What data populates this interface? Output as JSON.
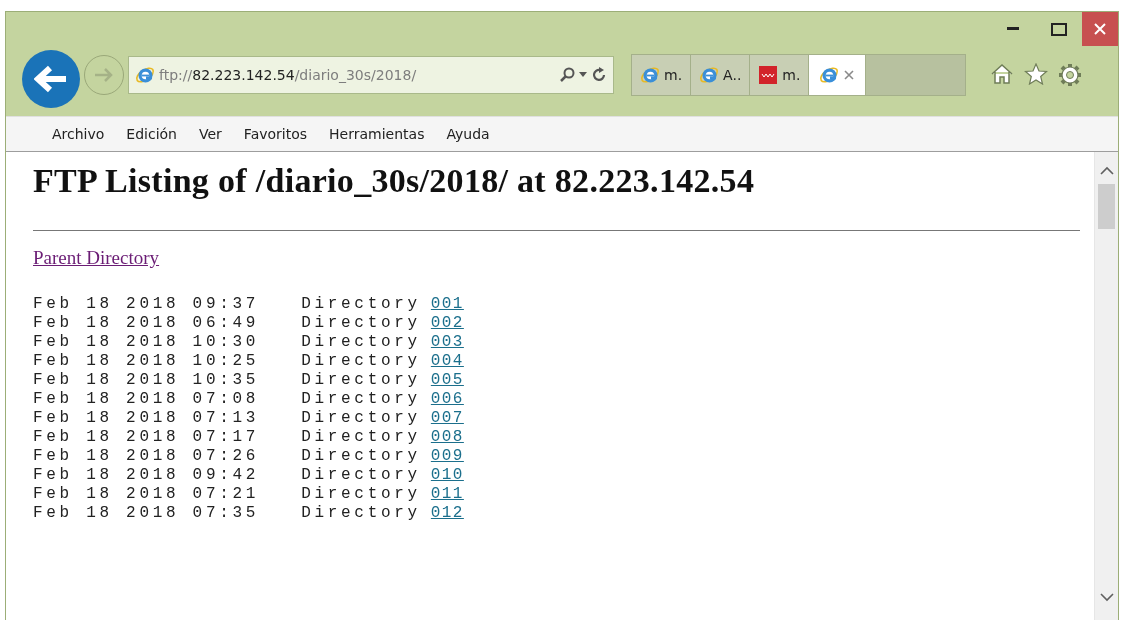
{
  "address_bar": {
    "scheme": "ftp://",
    "host": "82.223.142.54",
    "path": "/diario_30s/2018/"
  },
  "tabs": [
    {
      "label": "m.",
      "kind": "ie",
      "selected": false
    },
    {
      "label": "A..",
      "kind": "ie",
      "selected": false
    },
    {
      "label": "m.",
      "kind": "site",
      "selected": false
    },
    {
      "kind": "ie",
      "selected": true
    }
  ],
  "menu": [
    "Archivo",
    "Edición",
    "Ver",
    "Favoritos",
    "Herramientas",
    "Ayuda"
  ],
  "page": {
    "heading": "FTP Listing of /diario_30s/2018/ at 82.223.142.54",
    "parent_link": {
      "label": "Parent Directory",
      "visited": true
    },
    "entries": [
      {
        "date": "Feb 18 2018 09:37",
        "type": "Directory",
        "name": "001",
        "visited": false
      },
      {
        "date": "Feb 18 2018 06:49",
        "type": "Directory",
        "name": "002",
        "visited": false
      },
      {
        "date": "Feb 18 2018 10:30",
        "type": "Directory",
        "name": "003",
        "visited": false
      },
      {
        "date": "Feb 18 2018 10:25",
        "type": "Directory",
        "name": "004",
        "visited": false
      },
      {
        "date": "Feb 18 2018 10:35",
        "type": "Directory",
        "name": "005",
        "visited": false
      },
      {
        "date": "Feb 18 2018 07:08",
        "type": "Directory",
        "name": "006",
        "visited": false
      },
      {
        "date": "Feb 18 2018 07:13",
        "type": "Directory",
        "name": "007",
        "visited": false
      },
      {
        "date": "Feb 18 2018 07:17",
        "type": "Directory",
        "name": "008",
        "visited": false
      },
      {
        "date": "Feb 18 2018 07:26",
        "type": "Directory",
        "name": "009",
        "visited": false
      },
      {
        "date": "Feb 18 2018 09:42",
        "type": "Directory",
        "name": "010",
        "visited": false
      },
      {
        "date": "Feb 18 2018 07:21",
        "type": "Directory",
        "name": "011",
        "visited": false
      },
      {
        "date": "Feb 18 2018 07:35",
        "type": "Directory",
        "name": "012",
        "visited": false
      }
    ]
  }
}
